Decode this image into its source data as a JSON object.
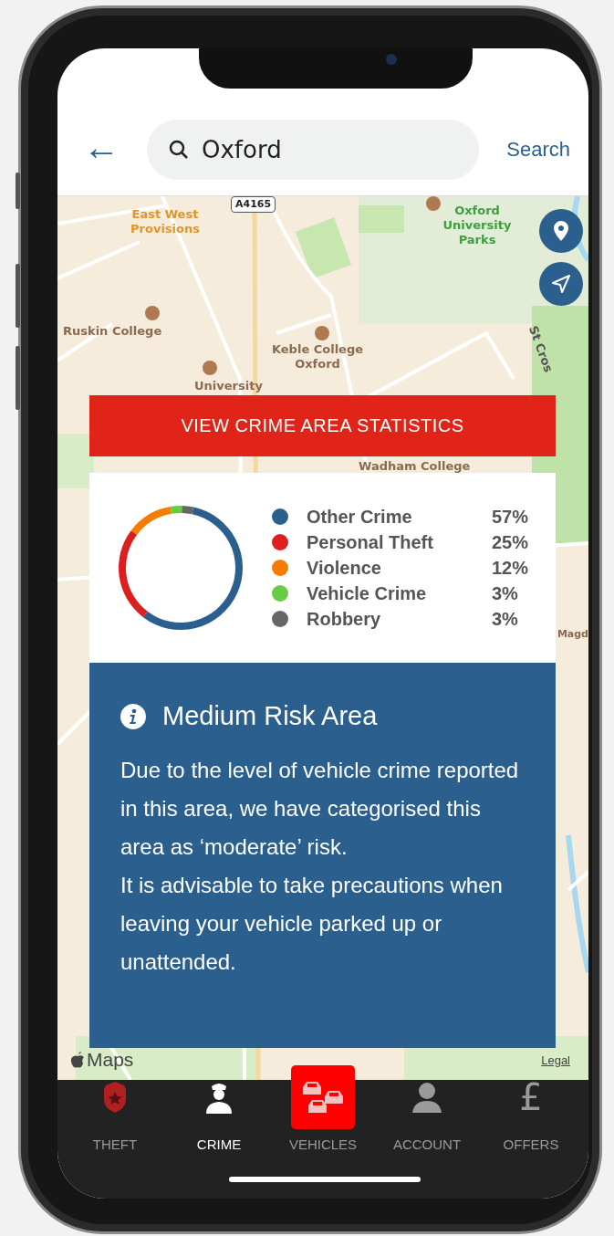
{
  "header": {
    "back_icon": "←",
    "search": {
      "value": "Oxford"
    },
    "search_link": "Search"
  },
  "map": {
    "labels": [
      {
        "text": "East West Provisions",
        "kind": "poi"
      },
      {
        "text": "A4165",
        "kind": "road"
      },
      {
        "text": "Oxford University Parks",
        "kind": "park"
      },
      {
        "text": "Ruskin College",
        "kind": "college"
      },
      {
        "text": "Keble College Oxford",
        "kind": "college"
      },
      {
        "text": "University",
        "kind": "college"
      },
      {
        "text": "Wadham College",
        "kind": "college"
      },
      {
        "text": "St Cros",
        "kind": "street"
      },
      {
        "text": "Magd",
        "kind": "college"
      }
    ],
    "attribution": "Maps",
    "legal_link": "Legal"
  },
  "stats_button": "VIEW CRIME AREA STATISTICS",
  "breakdown": {
    "legend": [
      {
        "name": "Other Crime",
        "percent": "57%",
        "color": "#2a5f8e"
      },
      {
        "name": "Personal Theft",
        "percent": "25%",
        "color": "#dc2020"
      },
      {
        "name": "Violence",
        "percent": "12%",
        "color": "#f57c00"
      },
      {
        "name": "Vehicle Crime",
        "percent": "3%",
        "color": "#66cc44"
      },
      {
        "name": "Robbery",
        "percent": "3%",
        "color": "#666666"
      }
    ],
    "chart_data": {
      "type": "donut",
      "values": [
        57,
        25,
        12,
        3,
        3
      ]
    }
  },
  "risk": {
    "title": "Medium Risk Area",
    "paragraphs": [
      "Due to the level of vehicle crime reported in this area, we have categorised this area as ‘moderate’ risk.",
      "It is advisable to take precautions when leaving your vehicle parked up or unattended."
    ]
  },
  "nav": [
    {
      "label": "THEFT",
      "kind": "badge",
      "selected": false,
      "highlighted": false
    },
    {
      "label": "CRIME",
      "kind": "officer",
      "selected": true,
      "highlighted": false
    },
    {
      "label": "VEHICLES",
      "kind": "cars",
      "selected": false,
      "highlighted": true
    },
    {
      "label": "ACCOUNT",
      "kind": "person",
      "selected": false,
      "highlighted": false
    },
    {
      "label": "OFFERS",
      "kind": "pound",
      "glyph": "£",
      "selected": false,
      "highlighted": false
    }
  ]
}
